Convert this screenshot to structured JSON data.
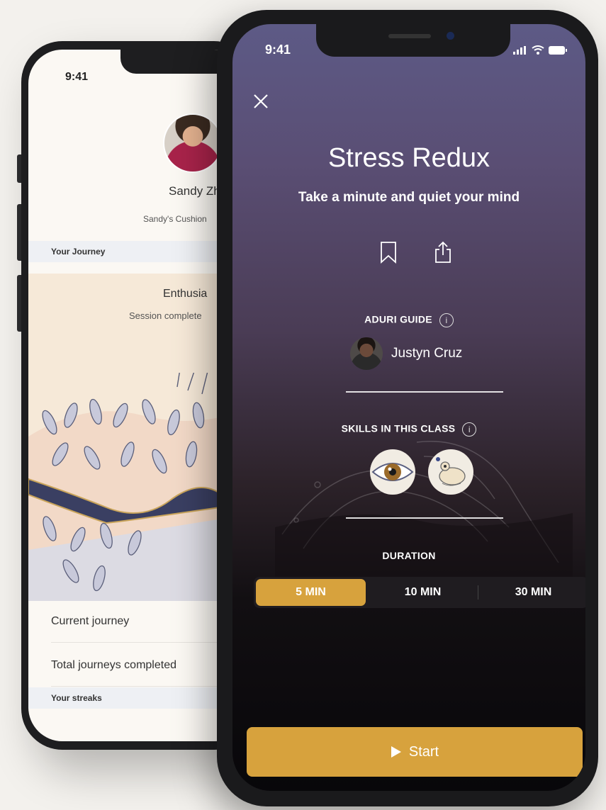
{
  "back_phone": {
    "time": "9:41",
    "profile_name": "Sandy Zh",
    "cushion": "Sandy's Cushion",
    "section_journey": "Your Journey",
    "journey_title": "Enthusia",
    "journey_sub": "Session complete",
    "row_current": "Current journey",
    "row_total": "Total journeys completed",
    "section_streaks": "Your streaks"
  },
  "front_phone": {
    "time": "9:41",
    "title": "Stress Redux",
    "subtitle": "Take a minute and quiet your mind",
    "close_icon": "close-icon",
    "bookmark_icon": "bookmark-icon",
    "share_icon": "share-icon",
    "guide_label": "ADURI GUIDE",
    "info_glyph": "i",
    "guide_name": "Justyn Cruz",
    "skills_label": "SKILLS IN THIS CLASS",
    "duration_label": "DURATION",
    "durations": [
      "5 MIN",
      "10 MIN",
      "30 MIN"
    ],
    "selected_duration": "5 MIN",
    "start_label": "Start",
    "accent_color": "#d7a23d"
  }
}
